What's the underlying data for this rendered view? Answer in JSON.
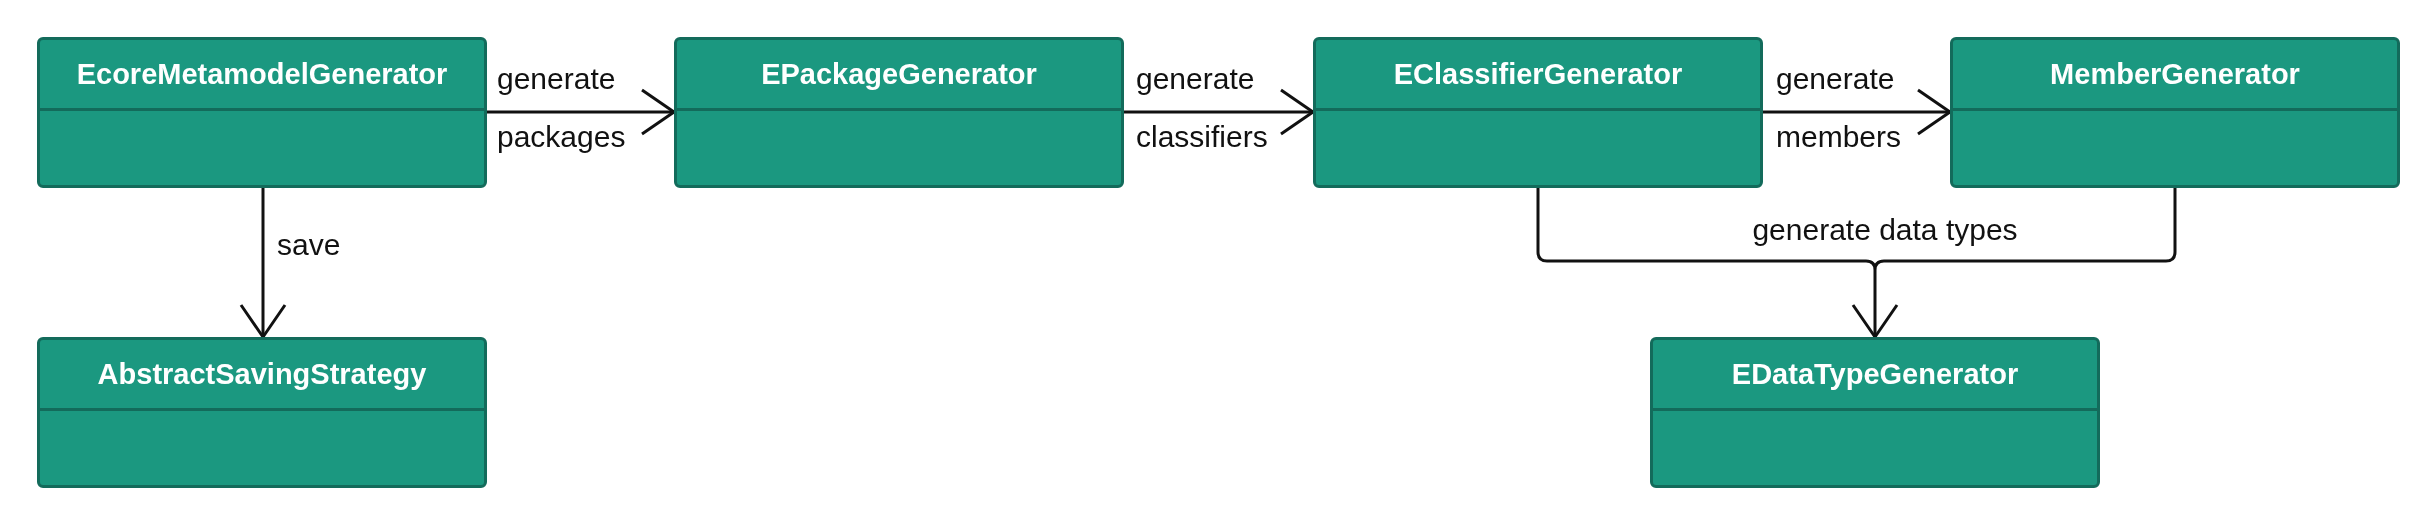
{
  "classes": [
    {
      "name": "EcoreMetamodelGenerator"
    },
    {
      "name": "EPackageGenerator"
    },
    {
      "name": "EClassifierGenerator"
    },
    {
      "name": "MemberGenerator"
    },
    {
      "name": "AbstractSavingStrategy"
    },
    {
      "name": "EDataTypeGenerator"
    }
  ],
  "associations": [
    {
      "labels": [
        "generate",
        "packages"
      ]
    },
    {
      "labels": [
        "generate",
        "classifiers"
      ]
    },
    {
      "labels": [
        "generate",
        "members"
      ]
    },
    {
      "labels": [
        "save"
      ]
    },
    {
      "labels": [
        "generate data types"
      ]
    }
  ]
}
